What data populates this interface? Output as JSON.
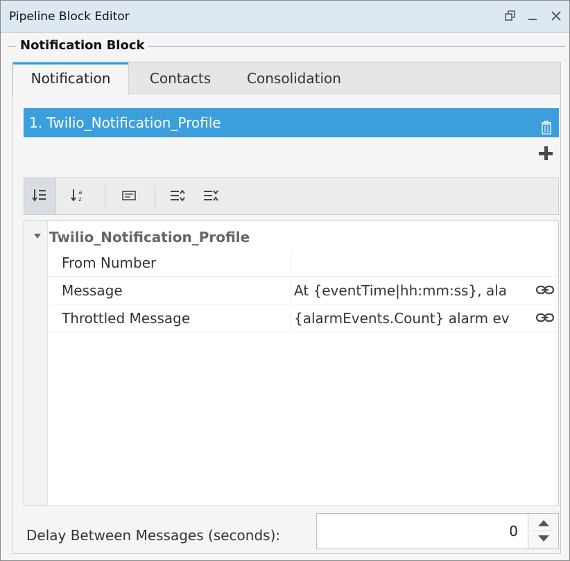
{
  "window": {
    "title": "Pipeline Block Editor",
    "restore_icon": "restore-window-icon",
    "minimize_icon": "minimize-icon",
    "close_icon": "close-icon"
  },
  "section": {
    "title": "Notification Block"
  },
  "tabs": [
    {
      "label": "Notification",
      "active": true
    },
    {
      "label": "Contacts",
      "active": false
    },
    {
      "label": "Consolidation",
      "active": false
    }
  ],
  "profile": {
    "label": "1.  Twilio_Notification_Profile",
    "delete_icon": "trash-icon",
    "color": "#3b9fdc"
  },
  "add_icon": "plus-icon",
  "toolbar": {
    "icons": [
      "sort-categorized-icon",
      "sort-alphabetical-icon",
      "description-icon",
      "expand-all-icon",
      "collapse-all-icon"
    ]
  },
  "property_grid": {
    "group_name": "Twilio_Notification_Profile",
    "rows": [
      {
        "name": "From Number",
        "value": "",
        "bound": false
      },
      {
        "name": "Message",
        "value": "At {eventTime|hh:mm:ss}, ala",
        "bound": true
      },
      {
        "name": "Throttled Message",
        "value": "{alarmEvents.Count} alarm ev",
        "bound": true
      }
    ]
  },
  "delay": {
    "label": "Delay Between Messages (seconds):",
    "value": "0"
  }
}
